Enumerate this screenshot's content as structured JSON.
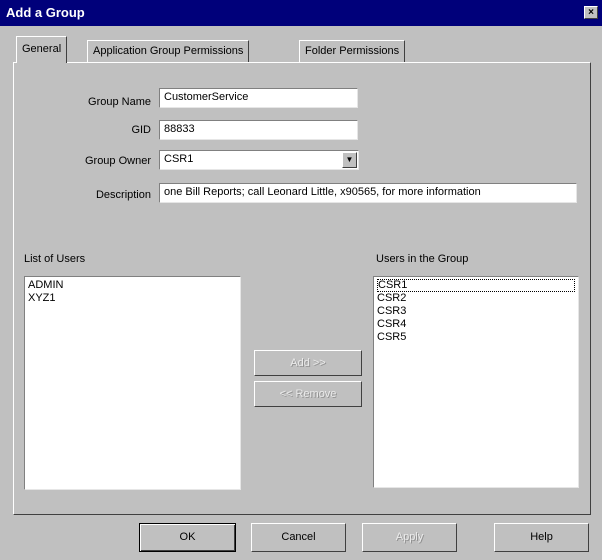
{
  "window": {
    "title": "Add a Group",
    "close_symbol": "×"
  },
  "tabs": [
    {
      "label": "General",
      "active": true
    },
    {
      "label": "Application Group Permissions",
      "active": false
    },
    {
      "label": "Folder Permissions",
      "active": false
    }
  ],
  "form": {
    "group_name": {
      "label": "Group Name",
      "value": "CustomerService"
    },
    "gid": {
      "label": "GID",
      "value": "88833"
    },
    "group_owner": {
      "label": "Group Owner",
      "value": "CSR1"
    },
    "description": {
      "label": "Description",
      "value": "one Bill Reports; call Leonard Little, x90565, for more information"
    }
  },
  "list_of_users": {
    "label": "List of Users",
    "items": [
      "ADMIN",
      "XYZ1"
    ]
  },
  "users_in_group": {
    "label": "Users in the Group",
    "items": [
      "CSR1",
      "CSR2",
      "CSR3",
      "CSR4",
      "CSR5"
    ],
    "selected": "CSR1"
  },
  "transfer": {
    "add_label": "Add >>",
    "remove_label": "<< Remove"
  },
  "footer": {
    "ok": "OK",
    "cancel": "Cancel",
    "apply": "Apply",
    "help": "Help"
  }
}
